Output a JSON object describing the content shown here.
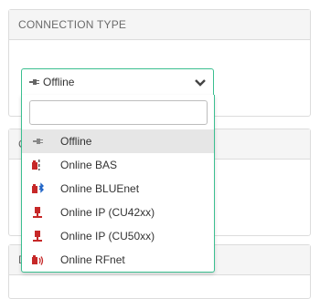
{
  "panel_top": {
    "title": "CONNECTION TYPE"
  },
  "panel_mid": {
    "title_clip": "C"
  },
  "panel_bot": {
    "title_clip": "D"
  },
  "select": {
    "value": "Offline"
  },
  "dropdown": {
    "search_placeholder": "",
    "options": [
      {
        "label": "Offline",
        "icon": "plug-icon",
        "selected": true
      },
      {
        "label": "Online BAS",
        "icon": "bas-icon"
      },
      {
        "label": "Online BLUEnet",
        "icon": "bluetooth-icon"
      },
      {
        "label": "Online IP (CU42xx)",
        "icon": "network-icon"
      },
      {
        "label": "Online IP (CU50xx)",
        "icon": "network-icon"
      },
      {
        "label": "Online RFnet",
        "icon": "rfnet-icon"
      }
    ]
  },
  "colors": {
    "accent": "#3bbf90",
    "selected_bg": "#e6e6e6"
  }
}
